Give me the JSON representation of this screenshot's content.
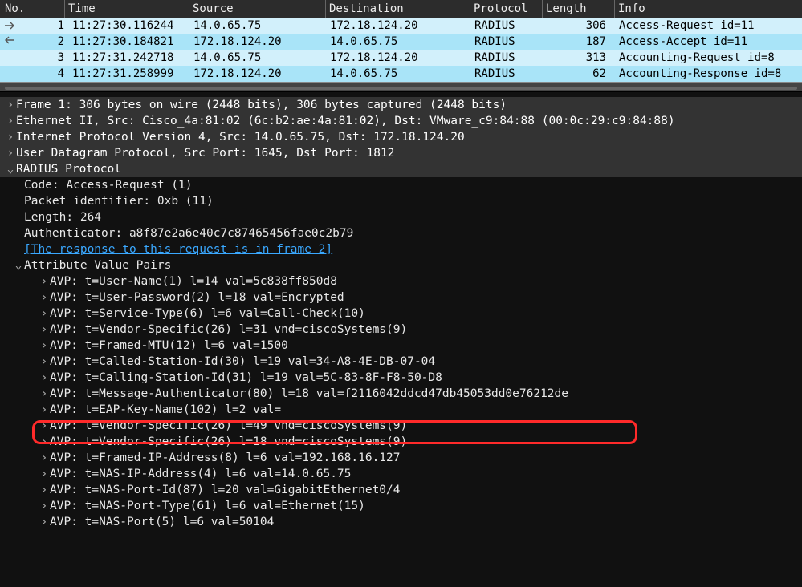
{
  "columns": {
    "no": "No.",
    "time": "Time",
    "source": "Source",
    "destination": "Destination",
    "protocol": "Protocol",
    "length": "Length",
    "info": "Info"
  },
  "packets": [
    {
      "no": "1",
      "time": "11:27:30.116244",
      "src": "14.0.65.75",
      "dst": "172.18.124.20",
      "prot": "RADIUS",
      "len": "306",
      "info": "Access-Request id=11"
    },
    {
      "no": "2",
      "time": "11:27:30.184821",
      "src": "172.18.124.20",
      "dst": "14.0.65.75",
      "prot": "RADIUS",
      "len": "187",
      "info": "Access-Accept id=11"
    },
    {
      "no": "3",
      "time": "11:27:31.242718",
      "src": "14.0.65.75",
      "dst": "172.18.124.20",
      "prot": "RADIUS",
      "len": "313",
      "info": "Accounting-Request id=8"
    },
    {
      "no": "4",
      "time": "11:27:31.258999",
      "src": "172.18.124.20",
      "dst": "14.0.65.75",
      "prot": "RADIUS",
      "len": "62",
      "info": "Accounting-Response id=8"
    }
  ],
  "detail": {
    "frame": "Frame 1: 306 bytes on wire (2448 bits), 306 bytes captured (2448 bits)",
    "eth": "Ethernet II, Src: Cisco_4a:81:02 (6c:b2:ae:4a:81:02), Dst: VMware_c9:84:88 (00:0c:29:c9:84:88)",
    "ip": "Internet Protocol Version 4, Src: 14.0.65.75, Dst: 172.18.124.20",
    "udp": "User Datagram Protocol, Src Port: 1645, Dst Port: 1812",
    "radius": "RADIUS Protocol",
    "code": "Code: Access-Request (1)",
    "pktid": "Packet identifier: 0xb (11)",
    "length": "Length: 264",
    "auth": "Authenticator: a8f87e2a6e40c7c87465456fae0c2b79",
    "respref": "[The response to this request is in frame 2]",
    "avphdr": "Attribute Value Pairs",
    "avp": [
      "AVP: t=User-Name(1) l=14 val=5c838ff850d8",
      "AVP: t=User-Password(2) l=18 val=Encrypted",
      "AVP: t=Service-Type(6) l=6 val=Call-Check(10)",
      "AVP: t=Vendor-Specific(26) l=31 vnd=ciscoSystems(9)",
      "AVP: t=Framed-MTU(12) l=6 val=1500",
      "AVP: t=Called-Station-Id(30) l=19 val=34-A8-4E-DB-07-04",
      "AVP: t=Calling-Station-Id(31) l=19 val=5C-83-8F-F8-50-D8",
      "AVP: t=Message-Authenticator(80) l=18 val=f2116042ddcd47db45053dd0e76212de",
      "AVP: t=EAP-Key-Name(102) l=2 val=",
      "AVP: t=Vendor-Specific(26) l=49 vnd=ciscoSystems(9)",
      "AVP: t=Vendor-Specific(26) l=18 vnd=ciscoSystems(9)",
      "AVP: t=Framed-IP-Address(8) l=6 val=192.168.16.127",
      "AVP: t=NAS-IP-Address(4) l=6 val=14.0.65.75",
      "AVP: t=NAS-Port-Id(87) l=20 val=GigabitEthernet0/4",
      "AVP: t=NAS-Port-Type(61) l=6 val=Ethernet(15)",
      "AVP: t=NAS-Port(5) l=6 val=50104"
    ]
  },
  "glyphs": {
    "right": "›",
    "down": "⌄"
  }
}
